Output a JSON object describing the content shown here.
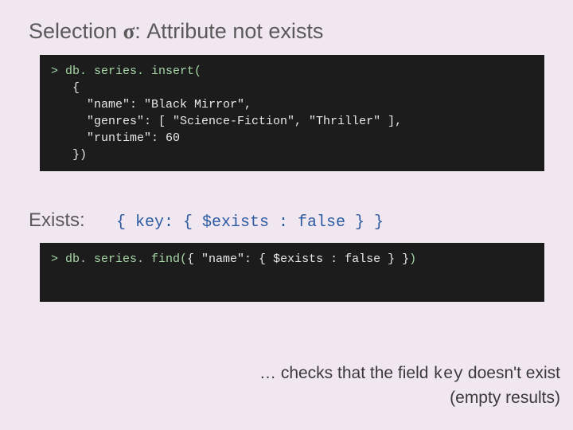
{
  "title": {
    "pre": "Selection ",
    "sigma": "σ",
    "post": ": Attribute not exists"
  },
  "code1": {
    "prompt": ">",
    "cmd": " db. series. insert(",
    "body": "   {\n     \"name\": \"Black Mirror\",\n     \"genres\": [ \"Science-Fiction\", \"Thriller\" ],\n     \"runtime\": 60\n   })"
  },
  "exists": {
    "label": "Exists:",
    "expr": "{ key: { $exists : false } }"
  },
  "code2": {
    "prompt": ">",
    "cmd": " db. series. find(",
    "arg": "{ \"name\": { $exists : false } }",
    "close": ")"
  },
  "footer": {
    "l1a": "… checks that the field ",
    "l1key": "key",
    "l1b": " doesn't exist",
    "l2": "(empty results)"
  }
}
